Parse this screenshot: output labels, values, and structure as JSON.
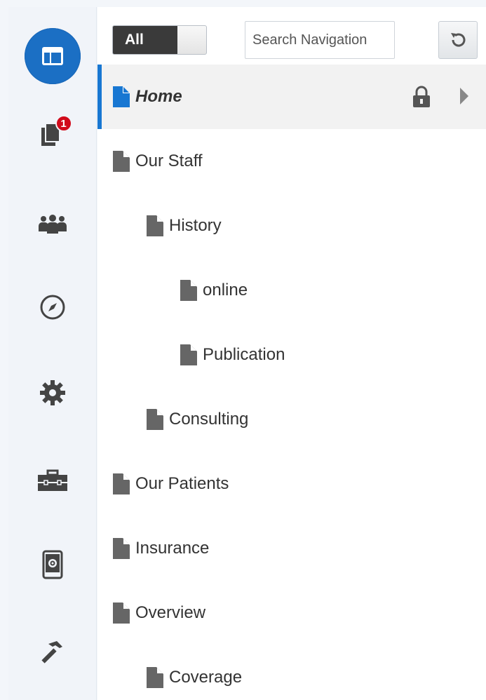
{
  "rail": {
    "badge_count": "1",
    "items": [
      {
        "icon": "page-layout-icon"
      },
      {
        "icon": "documents-icon"
      },
      {
        "icon": "people-icon"
      },
      {
        "icon": "compass-icon"
      },
      {
        "icon": "gear-icon"
      },
      {
        "icon": "toolbox-icon"
      },
      {
        "icon": "mobile-settings-icon"
      },
      {
        "icon": "hammer-icon"
      }
    ]
  },
  "toolbar": {
    "toggle_label": "All",
    "search_placeholder": "Search Navigation",
    "refresh_icon": "refresh-icon"
  },
  "tree": {
    "items": [
      {
        "label": "Home",
        "level": 0,
        "selected": true
      },
      {
        "label": "Our Staff",
        "level": 0
      },
      {
        "label": "History",
        "level": 1
      },
      {
        "label": "online",
        "level": 2
      },
      {
        "label": "Publication",
        "level": 2
      },
      {
        "label": "Consulting",
        "level": 1
      },
      {
        "label": "Our Patients",
        "level": 0
      },
      {
        "label": "Insurance",
        "level": 0
      },
      {
        "label": "Overview",
        "level": 0
      },
      {
        "label": "Coverage",
        "level": 1
      }
    ]
  },
  "colors": {
    "accent": "#1b6fc4",
    "badge": "#d10a1b",
    "selected_bar": "#1877d2"
  }
}
